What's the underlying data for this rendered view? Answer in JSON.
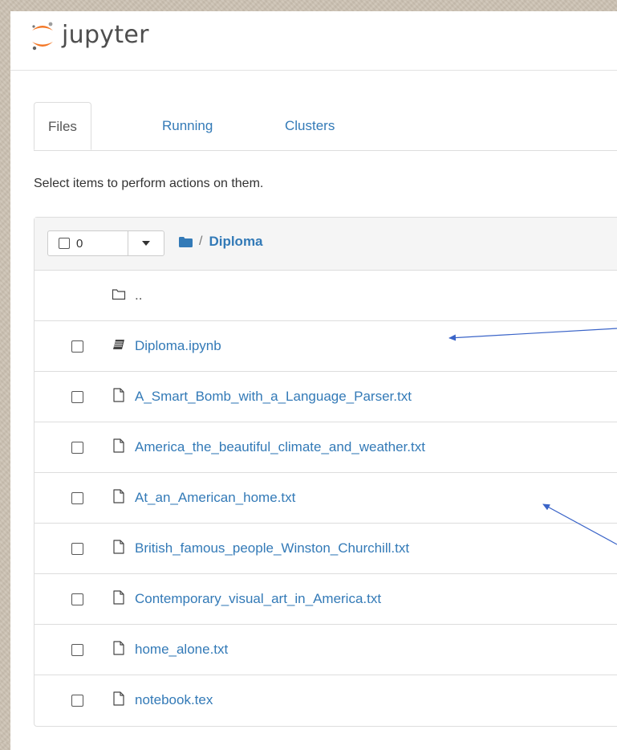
{
  "app": {
    "name": "jupyter"
  },
  "tabs": [
    {
      "label": "Files",
      "active": true
    },
    {
      "label": "Running",
      "active": false
    },
    {
      "label": "Clusters",
      "active": false
    }
  ],
  "instructions": "Select items to perform actions on them.",
  "toolbar": {
    "selected_count": "0"
  },
  "breadcrumb": {
    "separator": "/",
    "current": "Diploma"
  },
  "files": {
    "parent": "..",
    "items": [
      {
        "name": "Diploma.ipynb",
        "type": "notebook"
      },
      {
        "name": "A_Smart_Bomb_with_a_Language_Parser.txt",
        "type": "file"
      },
      {
        "name": "America_the_beautiful_climate_and_weather.txt",
        "type": "file"
      },
      {
        "name": "At_an_American_home.txt",
        "type": "file"
      },
      {
        "name": "British_famous_people_Winston_Churchill.txt",
        "type": "file"
      },
      {
        "name": "Contemporary_visual_art_in_America.txt",
        "type": "file"
      },
      {
        "name": "home_alone.txt",
        "type": "file"
      },
      {
        "name": "notebook.tex",
        "type": "file"
      }
    ]
  },
  "colors": {
    "link": "#337ab7",
    "logo_orange": "#f37726",
    "annotation": "#3a64c8",
    "backdrop": "#cdc3b4"
  }
}
